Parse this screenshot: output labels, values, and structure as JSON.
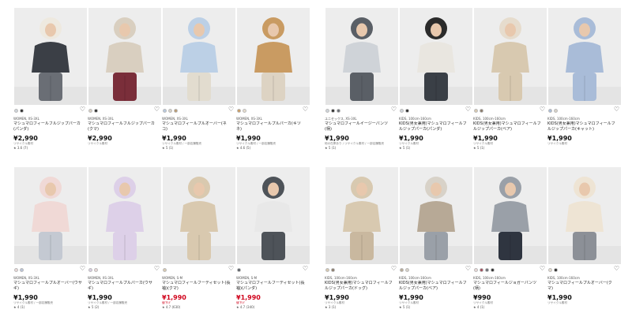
{
  "colors": {
    "sale": "#d0021b",
    "text": "#222222",
    "photo_bg": "#ececec"
  },
  "panels": [
    {
      "rows": [
        [
          {
            "tag": "WOMEN, XS-3XL",
            "name": "マシュマロフィールフルジップパーカ(パンダ)",
            "price": "¥2,990",
            "note": "リサイクル素材",
            "rating": "★ 3.6 (7)",
            "swatches": [
              "#cfd4da",
              "#2b2b2b"
            ],
            "sale": false
          },
          {
            "tag": "WOMEN, XS-3XL",
            "name": "マシュマロフィールフルジップパーカ(クマ)",
            "price": "¥2,990",
            "note": "リサイクル素材",
            "rating": "",
            "swatches": [
              "#d9cfc2",
              "#2b2b2b"
            ],
            "sale": false
          },
          {
            "tag": "WOMEN, XS-3XL",
            "name": "マシュマロフィールプルオーバー(ネコ)",
            "price": "¥1,990",
            "note": "リサイクル素材 / 一部店舗販売",
            "rating": "★ 5 (1)",
            "swatches": [
              "#b7c9de",
              "#d8d2c8",
              "#b99a72"
            ],
            "sale": false
          },
          {
            "tag": "WOMEN, XS-3XL",
            "name": "マシュマロフィールプルパーカ(キツネ)",
            "price": "¥1,990",
            "note": "リサイクル素材 / 一部店舗販売",
            "rating": "★ 4.6 (5)",
            "swatches": [
              "#c99b62",
              "#e6dccd"
            ],
            "sale": false
          }
        ],
        [
          {
            "tag": "WOMEN, XS-3XL",
            "name": "マシュマロフィールプルオーバー(ウサギ)",
            "price": "¥1,990",
            "note": "リサイクル素材 / 一部店舗販売",
            "rating": "★ 4 (1)",
            "swatches": [
              "#e9d8d6",
              "#b9c4d8"
            ],
            "sale": false
          },
          {
            "tag": "WOMEN, XS-3XL",
            "name": "マシュマロフィールプルパーカ(ウサギ)",
            "price": "¥1,990",
            "note": "リサイクル素材 / 一部店舗販売",
            "rating": "★ 5 (2)",
            "swatches": [
              "#d9cde3",
              "#e9d8d6"
            ],
            "sale": false
          },
          {
            "tag": "WOMEN, S-M",
            "name": "マシュマロフィールフーディセット(長袖)(クマ)",
            "price": "¥1,990",
            "note": "値下げ",
            "rating": "★ 4.7 (630)",
            "swatches": [
              "#d8c9b0"
            ],
            "sale": true
          },
          {
            "tag": "WOMEN, S-M",
            "name": "マシュマロフィールフーディセット(長袖)(パンダ)",
            "price": "¥1,990",
            "note": "値下げ",
            "rating": "★ 4.7 (340)",
            "swatches": [
              "#5a5f66"
            ],
            "sale": true
          }
        ]
      ]
    },
    {
      "rows": [
        [
          {
            "tag": "ユニセックス, XS-3XL",
            "name": "マシュマロフィールイージーパンツ(柄)",
            "price": "¥1,990",
            "note": "他の在庫あり / リサイクル素材 / 一部店舗販売",
            "rating": "★ 5 (1)",
            "swatches": [
              "#cfd4da",
              "#2b2b2b",
              "#6b6f75"
            ],
            "sale": false
          },
          {
            "tag": "KIDS, 100cm-160cm",
            "name": "KIDS(男女兼用)マシュマロフィールフルジップパーカ(パンダ)",
            "price": "¥1,990",
            "note": "リサイクル素材",
            "rating": "★ 5 (1)",
            "swatches": [
              "#cfd4da",
              "#2b2b2b"
            ],
            "sale": false
          },
          {
            "tag": "KIDS, 100cm-160cm",
            "name": "KIDS(男女兼用)マシュマロフィールフルジップパーカ(ベア)",
            "price": "¥1,990",
            "note": "リサイクル素材",
            "rating": "★ 5 (1)",
            "swatches": [
              "#d8c9b0",
              "#8a7a6a"
            ],
            "sale": false
          },
          {
            "tag": "KIDS, 100cm-160cm",
            "name": "KIDS(男女兼用)マシュマロフィールフルジップパーカ(キャット)",
            "price": "¥1,990",
            "note": "リサイクル素材",
            "rating": "",
            "swatches": [
              "#a9bcd8",
              "#d8d2c8"
            ],
            "sale": false
          }
        ],
        [
          {
            "tag": "KIDS, 100cm-160cm",
            "name": "KIDS(男女兼用)マシュマロフィールフルジップパーカ(ドッグ)",
            "price": "¥1,990",
            "note": "リサイクル素材",
            "rating": "★ 3 (1)",
            "swatches": [
              "#d8c9b0",
              "#8a7a6a"
            ],
            "sale": false
          },
          {
            "tag": "KIDS, 100cm-160cm",
            "name": "KIDS(男女兼用)マシュマロフィールフルジップパーカ(ベア)",
            "price": "¥1,990",
            "note": "リサイクル素材",
            "rating": "★ 5 (1)",
            "swatches": [
              "#b7a996",
              "#d8d2c8"
            ],
            "sale": false
          },
          {
            "tag": "KIDS, 100cm-160cm",
            "name": "マシュマロフィールジョガーパンツ(柄)",
            "price": "¥990",
            "note": "リサイクル素材",
            "rating": "★ 4 (1)",
            "swatches": [
              "#e9d8d6",
              "#a04a58",
              "#6b6f75",
              "#2b2b2b"
            ],
            "sale": false
          },
          {
            "tag": "KIDS, 100cm-160cm",
            "name": "マシュマロフィールプルオーバー(クマ)",
            "price": "¥1,990",
            "note": "リサイクル素材",
            "rating": "",
            "swatches": [
              "#e6dccd",
              "#2b2b2b"
            ],
            "sale": false
          }
        ]
      ]
    }
  ]
}
